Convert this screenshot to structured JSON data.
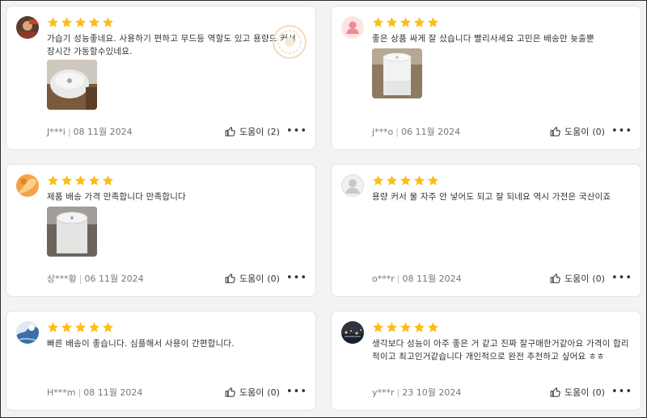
{
  "reviews": [
    {
      "author": "J***i",
      "date": "08 11월 2024",
      "rating": 5,
      "text": "가습기 성능좋네요. 사용하기 편하고 무드등 역할도 있고 용량도 커서 장시간 가동할수있네요.",
      "helpful_label": "도움이",
      "helpful_count": "(2)",
      "avatar": "photo-avatar",
      "has_photo": true
    },
    {
      "author": "j***o",
      "date": "06 11월 2024",
      "rating": 5,
      "text": "좋은 상품 싸게 잘 샀습니다 빨리사세요 고민은 배송만 늦출뿐",
      "helpful_label": "도움이",
      "helpful_count": "(0)",
      "avatar": "default-pink-avatar",
      "has_photo": true
    },
    {
      "author": "상***황",
      "date": "06 11월 2024",
      "rating": 5,
      "text": "제품 배송 가격 만족합니다 만족합니다",
      "helpful_label": "도움이",
      "helpful_count": "(0)",
      "avatar": "orange-avatar",
      "has_photo": true
    },
    {
      "author": "o***r",
      "date": "08 11월 2024",
      "rating": 5,
      "text": "용량 커서 물 자주 안 넣어도 되고 잘 되네요 역시 가전은 국산이죠",
      "helpful_label": "도움이",
      "helpful_count": "(0)",
      "avatar": "default-gray-avatar",
      "has_photo": false
    },
    {
      "author": "H***m",
      "date": "08 11월 2024",
      "rating": 5,
      "text": "빠른 배송이 좋습니다. 심플해서 사용이 간편합니다.",
      "helpful_label": "도움이",
      "helpful_count": "(0)",
      "avatar": "blue-avatar",
      "has_photo": false
    },
    {
      "author": "y***r",
      "date": "23 10월 2024",
      "rating": 5,
      "text": "생각보다 성능이 아주 좋은 거 같고 진짜 잘구매한거같아요 가격이 합리적이고 최고인거같습니다 개인적으로 완전 추천하고 싶어요 ㅎㅎ",
      "helpful_label": "도움이",
      "helpful_count": "(0)",
      "avatar": "night-photo-avatar",
      "has_photo": false
    }
  ],
  "colors": {
    "star": "#fbbd16",
    "background": "#f3f3f3",
    "card": "#ffffff",
    "border": "#e3e3e3",
    "meta_text": "#777777"
  },
  "icons": {
    "star": "star-icon",
    "helpful": "thumbs-up-icon",
    "more": "more-options-icon"
  }
}
